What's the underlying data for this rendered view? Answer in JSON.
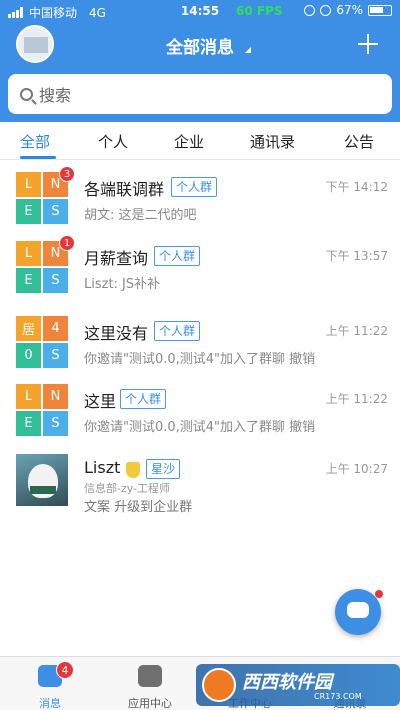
{
  "status_bar": {
    "carrier": "中国移动",
    "network": "4G",
    "time": "14:55",
    "fps": "60 FPS",
    "battery": "67%",
    "battery_level": 0.67
  },
  "nav": {
    "title": "全部消息"
  },
  "search": {
    "placeholder": "搜索"
  },
  "tabs": [
    "全部",
    "个人",
    "企业",
    "通讯录",
    "公告"
  ],
  "chats": [
    {
      "avatar": [
        "L",
        "N",
        "E",
        "S"
      ],
      "unread": "3",
      "name": "各端联调群",
      "tag": "个人群",
      "time": "下午 14:12",
      "preview": "胡文: 这是二代的吧"
    },
    {
      "avatar": [
        "L",
        "N",
        "E",
        "S"
      ],
      "unread": "1",
      "name": "月薪查询",
      "tag": "个人群",
      "time": "下午 13:57",
      "preview": "Liszt: JS补补"
    },
    {
      "avatar": [
        "居",
        "4",
        "0",
        "S"
      ],
      "name": "这里没有",
      "tag": "个人群",
      "time": "上午 11:22",
      "preview": "你邀请\"测试0.0,测试4\"加入了群聊 撤销"
    },
    {
      "avatar": [
        "L",
        "N",
        "E",
        "S"
      ],
      "name": "这里",
      "tag": "个人群",
      "time": "上午 11:22",
      "preview": "你邀请\"测试0.0,测试4\"加入了群聊 撤销"
    },
    {
      "name": "Liszt",
      "tag": "星沙",
      "time": "上午 10:27",
      "sub": "信息部-zy-工程师",
      "preview": "文案  升级到企业群"
    }
  ],
  "tabbar": {
    "items": [
      "消息",
      "应用中心",
      "工作中心",
      "通讯录"
    ],
    "messages_badge": "4"
  },
  "watermark": {
    "title": "西西软件园",
    "site": "CR173.COM"
  },
  "colors": {
    "primary": "#3d8fe6",
    "unread": "#e8353a",
    "fps": "#2de05a"
  }
}
